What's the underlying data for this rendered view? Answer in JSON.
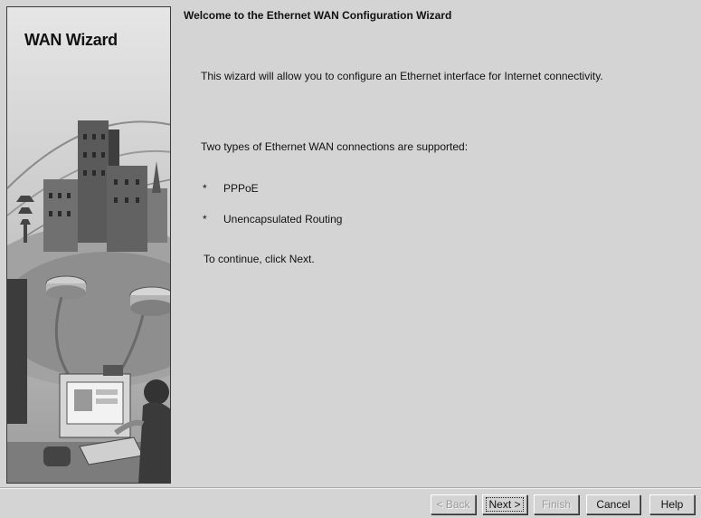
{
  "side_panel": {
    "title": "WAN Wizard"
  },
  "content": {
    "heading": "Welcome to the Ethernet WAN Configuration Wizard",
    "intro": "This wizard will allow you to configure an Ethernet interface for Internet connectivity.",
    "types_intro": "Two types of Ethernet WAN connections are supported:",
    "bullets": [
      {
        "star": "*",
        "text": "PPPoE"
      },
      {
        "star": "*",
        "text": "Unencapsulated Routing"
      }
    ],
    "continue_text": "To continue, click Next."
  },
  "buttons": {
    "back": "< Back",
    "next": "Next >",
    "finish": "Finish",
    "cancel": "Cancel",
    "help": "Help"
  }
}
